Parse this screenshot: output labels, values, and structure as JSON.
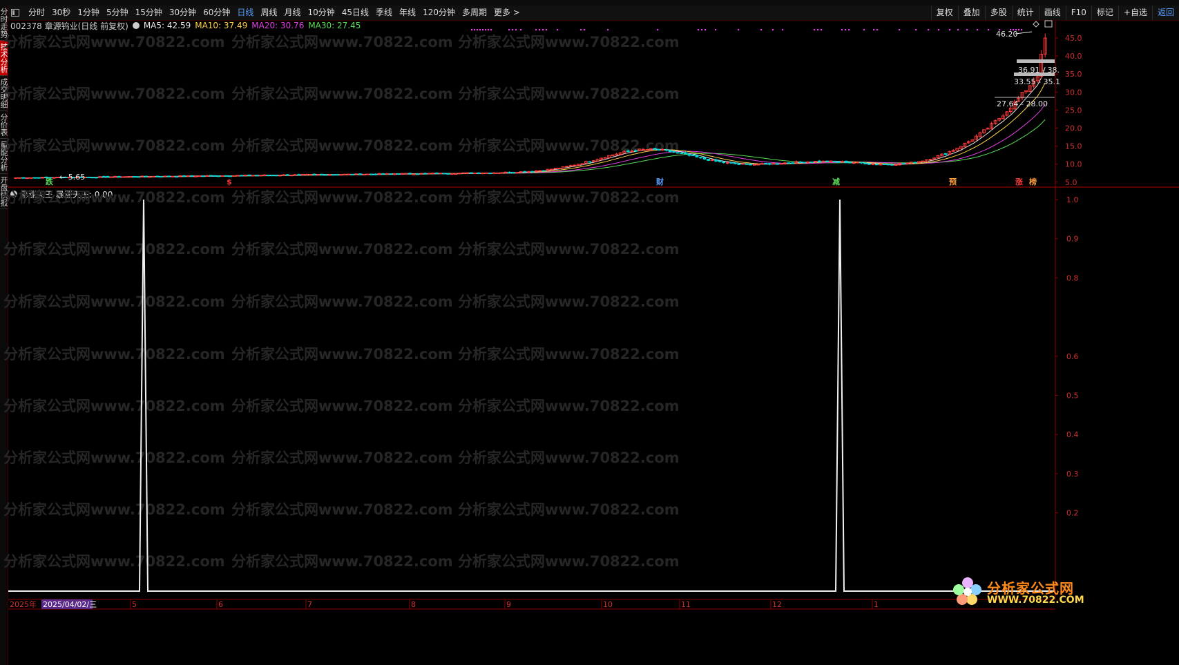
{
  "toolbar": {
    "periods": [
      "分时",
      "30秒",
      "1分钟",
      "5分钟",
      "15分钟",
      "30分钟",
      "60分钟",
      "日线",
      "周线",
      "月线",
      "10分钟",
      "45日线",
      "季线",
      "年线",
      "120分钟",
      "多周期",
      "更多 >"
    ],
    "active_period": "日线",
    "right_items": [
      "复权",
      "叠加",
      "多股",
      "统计",
      "画线",
      "F10",
      "标记",
      "+自选",
      "返回"
    ]
  },
  "side_tabs": [
    "分时走势",
    "技术分析",
    "成交明细",
    "分价表",
    "量能分析",
    "开盘快报"
  ],
  "side_active": "技术分析",
  "stock": {
    "title": "002378 章源钨业(日线 前复权)",
    "ma5": "MA5: 42.59",
    "ma10": "MA10: 37.49",
    "ma20": "MA20: 30.76",
    "ma30": "MA30: 27.45"
  },
  "indicator": {
    "label": "暴涨天王",
    "value_text": "暴涨天王: 0.00"
  },
  "price_axis": [
    "45.0",
    "40.0",
    "35.0",
    "30.0",
    "25.0",
    "20.0",
    "15.0",
    "10.0",
    "5.0"
  ],
  "ind_axis": [
    "1.0",
    "0.9",
    "0.8",
    "0.6",
    "0.5",
    "0.4",
    "0.3",
    "0.2"
  ],
  "annotations": {
    "high": "46.20",
    "low": "5.65",
    "box1": "36.91 - 38.",
    "box2": "33.55 - 35.1",
    "box3": "27.64 - 28.00"
  },
  "markers": [
    "跌",
    "$",
    "财",
    "减",
    "预",
    "涨",
    "榜"
  ],
  "date_axis": {
    "start": "2025年",
    "cursor": "2025/04/02/三",
    "months": [
      "5",
      "6",
      "7",
      "8",
      "9",
      "10",
      "11",
      "12",
      "1"
    ]
  },
  "watermark": "分析家公式网www.70822.com",
  "logo": {
    "title": "分析家公式网",
    "url": "WWW.70822.COM"
  },
  "colors": {
    "up": "#ff3b3b",
    "down": "#00d7d7",
    "ma5": "#e8e8e8",
    "ma10": "#ffd24a",
    "ma20": "#e040e0",
    "ma30": "#5adc5a",
    "grid": "#8b0000"
  }
}
